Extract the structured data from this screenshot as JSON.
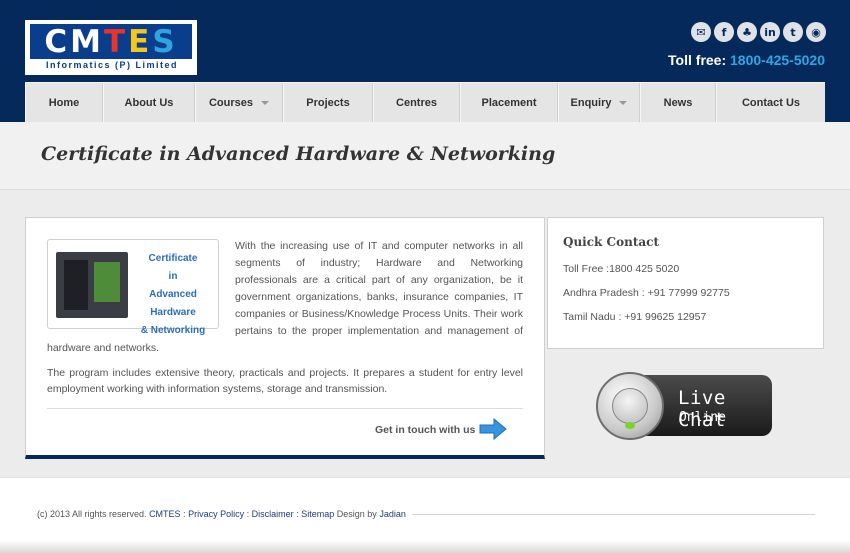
{
  "header": {
    "logo_text": [
      "CM",
      "T",
      "E",
      "S"
    ],
    "logo_sub": "Informatics (P) Limited",
    "socials": [
      {
        "icon": "mail-icon",
        "glyph": "✉"
      },
      {
        "icon": "facebook-icon",
        "glyph": "f"
      },
      {
        "icon": "blogger-icon",
        "glyph": "♣"
      },
      {
        "icon": "linkedin-icon",
        "glyph": "in"
      },
      {
        "icon": "twitter-icon",
        "glyph": "t"
      },
      {
        "icon": "rss-icon",
        "glyph": "◉"
      }
    ],
    "tollfree_label": "Toll free:",
    "tollfree_number": "1800-425-5020"
  },
  "nav": {
    "items": [
      {
        "label": "Home",
        "dropdown": false
      },
      {
        "label": "About Us",
        "dropdown": false
      },
      {
        "label": "Courses",
        "dropdown": true
      },
      {
        "label": "Projects",
        "dropdown": false
      },
      {
        "label": "Centres",
        "dropdown": false
      },
      {
        "label": "Placement",
        "dropdown": false
      },
      {
        "label": "Enquiry",
        "dropdown": true
      },
      {
        "label": "News",
        "dropdown": false
      },
      {
        "label": "Contact Us",
        "dropdown": false
      }
    ]
  },
  "page": {
    "title": "Certificate in Advanced Hardware & Networking",
    "thumb_lines": [
      "Certificate",
      "in",
      "Advanced Hardware",
      "& Networking"
    ],
    "intro": "With the increasing use of IT and computer networks in all segments of industry; Hardware and Networking professionals are a critical part of any organization, be it government organizations, banks, insurance companies, IT companies or Business/Knowledge Process Units. Their work pertains to the proper implementation and management of hardware and networks.",
    "para2": "The program includes extensive theory, practicals and projects. It prepares a student for entry level employment working with information systems, storage and transmission.",
    "cta_label": "Get in touch with us"
  },
  "quick_contact": {
    "title": "Quick Contact",
    "lines": [
      "Toll Free :1800 425 5020",
      "Andhra Pradesh : +91 77999 92775",
      "Tamil Nadu : +91 99625 12957"
    ]
  },
  "live_chat": {
    "title": "Live Chat",
    "subtitle": "Online"
  },
  "footer": {
    "copyright": "(c) 2013 All rights reserved.",
    "brand": "CMTES",
    "sep1": ":",
    "privacy": "Privacy Policy",
    "sep2": ":",
    "disclaimer": "Disclaimer",
    "sep3": ":",
    "sitemap": "Sitemap",
    "designed_by": "Design by",
    "designer": "Jadian"
  }
}
